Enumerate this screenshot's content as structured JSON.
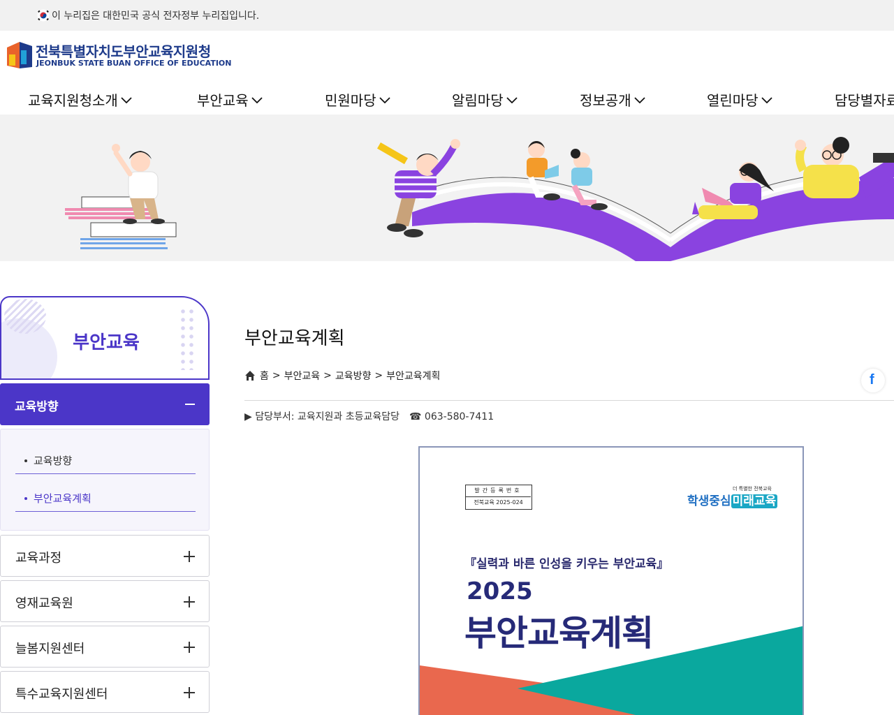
{
  "gov_bar": {
    "text": "이 누리집은 대한민국 공식 전자정부 누리집입니다."
  },
  "logo": {
    "name_kr": "전북특별자치도부안교육지원청",
    "name_en": "JEONBUK STATE BUAN OFFICE OF EDUCATION"
  },
  "gnb": {
    "items": [
      {
        "label": "교육지원청소개"
      },
      {
        "label": "부안교육"
      },
      {
        "label": "민원마당"
      },
      {
        "label": "알림마당"
      },
      {
        "label": "정보공개"
      },
      {
        "label": "열린마당"
      },
      {
        "label": "담당별자료"
      }
    ]
  },
  "sidebar": {
    "title": "부안교육",
    "active_section": "교육방향",
    "sub_items": [
      {
        "label": "교육방향"
      },
      {
        "label": "부안교육계획"
      }
    ],
    "sections": [
      {
        "label": "교육과정"
      },
      {
        "label": "영재교육원"
      },
      {
        "label": "늘봄지원센터"
      },
      {
        "label": "특수교육지원센터"
      }
    ]
  },
  "content": {
    "title": "부안교육계획",
    "breadcrumb": [
      "홈",
      "부안교육",
      "교육방향",
      "부안교육계획"
    ],
    "breadcrumb_sep": ">",
    "dept": "▶ 담당부서: 교육지원과 초등교육담당",
    "tel": "☎ 063-580-7411",
    "facebook_label": "f"
  },
  "cover": {
    "reg_label": "발간등록번호",
    "reg_no": "전북교육 2025-024",
    "slogan_small": "더 특별한 전북교육",
    "slogan_a": "학생중심",
    "slogan_b": "미래교육",
    "motto": "『실력과 바른 인성을 키우는 부안교육』",
    "year": "2025",
    "title": "부안교육계획"
  },
  "colors": {
    "primary": "#4b36c8",
    "brand_navy": "#1d3a8a",
    "cover_teal": "#0aa89e",
    "cover_coral": "#e9684e"
  }
}
